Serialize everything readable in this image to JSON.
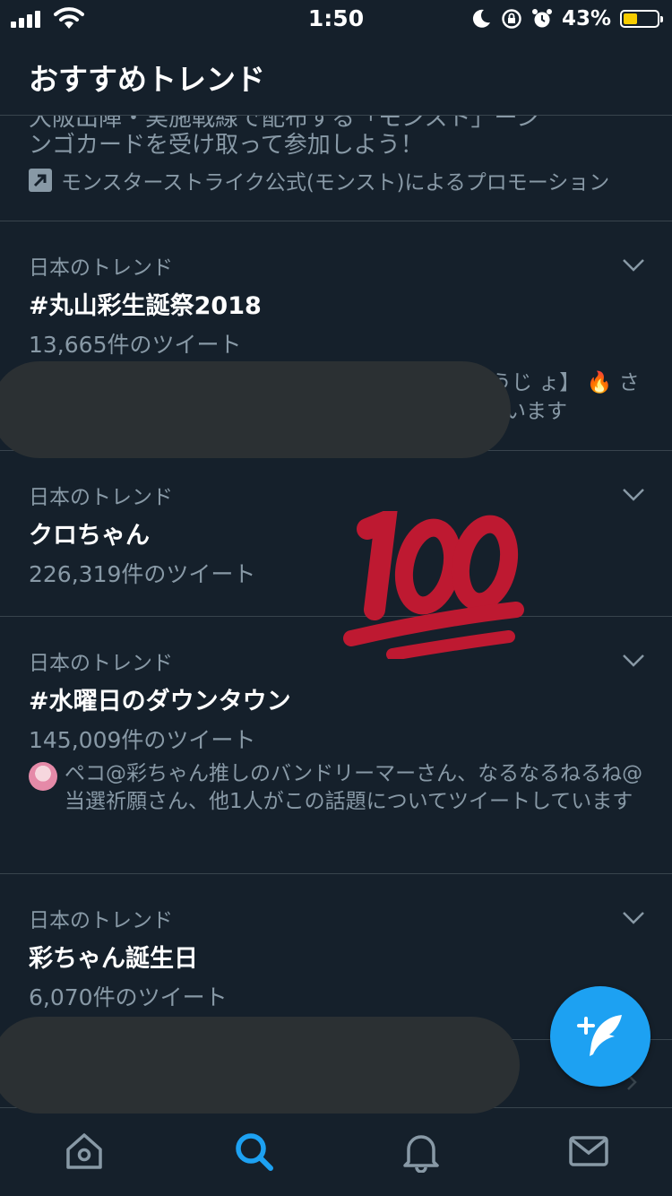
{
  "status_bar": {
    "time": "1:50",
    "battery_percent": "43%",
    "battery_level": 0.43,
    "icons": [
      "signal-icon",
      "wifi-icon",
      "moon-icon",
      "rotation-lock-icon",
      "alarm-icon",
      "battery-icon"
    ]
  },
  "header": {
    "title": "おすすめトレンド"
  },
  "promo": {
    "cut_line": "大阪出陣・実施戦線で配布する「モンスト」ーン",
    "description": "ンゴカードを受け取って参加しよう！",
    "promoted_by": "モンスターストライク公式(モンスト)によるプロモーション",
    "icon": "promoted-arrow-icon"
  },
  "trends": [
    {
      "context": "日本のトレンド",
      "name": "#丸山彩生誕祭2018",
      "count": "13,665件のツイート",
      "partial_line1": "うじ ょ】 🔥 さ",
      "partial_line2": "います"
    },
    {
      "context": "日本のトレンド",
      "name": "クロちゃん",
      "count": "226,319件のツイート"
    },
    {
      "context": "日本のトレンド",
      "name": "#水曜日のダウンタウン",
      "count": "145,009件のツイート",
      "social": "ペコ@彩ちゃん推しのバンドリーマーさん、なるなるねるね@当選祈願さん、他1人がこの話題についてツイートしています"
    },
    {
      "context": "日本のトレンド",
      "name": "彩ちゃん誕生日",
      "count": "6,070件のツイート"
    }
  ],
  "overlay": {
    "emoji": "hundred-points-icon"
  },
  "fab": {
    "icon": "compose-tweet-icon"
  },
  "tabbar": {
    "tabs": [
      {
        "icon": "home-icon",
        "active": false
      },
      {
        "icon": "search-icon",
        "active": true
      },
      {
        "icon": "bell-icon",
        "active": false
      },
      {
        "icon": "mail-icon",
        "active": false
      }
    ]
  },
  "colors": {
    "background": "#15202b",
    "divider": "#38444d",
    "secondary_text": "#8899a6",
    "accent": "#1da1f2",
    "emoji_red": "#be1931",
    "redaction": "#2b3033"
  }
}
